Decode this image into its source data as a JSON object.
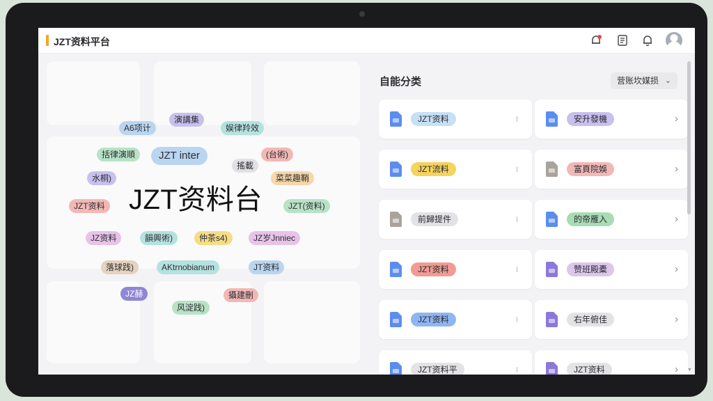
{
  "app": {
    "title": "JZT资料平台",
    "accent": "#f5a623"
  },
  "header": {
    "icons": [
      "notification-badge-icon",
      "document-list-icon",
      "bell-icon",
      "user-avatar-icon"
    ]
  },
  "cloud": {
    "headline": "JZT资料台",
    "tags": [
      {
        "text": "A6项计",
        "color": "c-blue"
      },
      {
        "text": "演講集",
        "color": "c-purple"
      },
      {
        "text": "娱律羚效",
        "color": "c-teal"
      },
      {
        "text": "括律演順",
        "color": "c-green"
      },
      {
        "text": "JZT inter",
        "color": "c-blue"
      },
      {
        "text": "搖載",
        "color": "c-gray"
      },
      {
        "text": "(台術)",
        "color": "c-red"
      },
      {
        "text": "水桐)",
        "color": "c-purple"
      },
      {
        "text": "菜菜趣鞘",
        "color": "c-orange"
      },
      {
        "text": "JZT资料",
        "color": "c-red"
      },
      {
        "text": "JZT(资料)",
        "color": "c-green"
      },
      {
        "text": "JZ资料",
        "color": "c-pink"
      },
      {
        "text": "韻興術)",
        "color": "c-teal"
      },
      {
        "text": "仲茶s4)",
        "color": "c-yellow"
      },
      {
        "text": "JZ岁Jnniec",
        "color": "c-pink"
      },
      {
        "text": "落球践)",
        "color": "c-tan"
      },
      {
        "text": "AKtrnobianum",
        "color": "c-teal"
      },
      {
        "text": "JT资料",
        "color": "c-blue"
      },
      {
        "text": "JZ赫",
        "color": "c-violet"
      },
      {
        "text": "攝建刪",
        "color": "c-red"
      },
      {
        "text": "风淀践)",
        "color": "c-green"
      }
    ]
  },
  "panel": {
    "title": "自能分类",
    "sort_label": "营账坎媒损",
    "cards": [
      {
        "label": "JZT资料",
        "tag_color": "#c6e0f6",
        "icon": "doc-blue"
      },
      {
        "label": "安升發機",
        "tag_color": "#c9c0ee",
        "icon": "doc-blue"
      },
      {
        "label": "JZT流料",
        "tag_color": "#f5d35c",
        "icon": "doc-blue"
      },
      {
        "label": "富頁院娛",
        "tag_color": "#f2b8b5",
        "icon": "doc-gray"
      },
      {
        "label": "前歸提件",
        "tag_color": "#e3e3e6",
        "icon": "doc-gray"
      },
      {
        "label": "的帝雁入",
        "tag_color": "#a8dcb5",
        "icon": "doc-blue"
      },
      {
        "label": "JZT资料",
        "tag_color": "#f09b93",
        "icon": "doc-blue"
      },
      {
        "label": "赞班殿橐",
        "tag_color": "#dcc6ec",
        "icon": "doc-purple"
      },
      {
        "label": "JZT资料",
        "tag_color": "#8fb6f3",
        "icon": "doc-blue"
      },
      {
        "label": "右年俯佳",
        "tag_color": "#e3e3e6",
        "icon": "doc-purple"
      },
      {
        "label": "JZT资料平",
        "tag_color": "#e3e3e6",
        "icon": "doc-blue"
      },
      {
        "label": "JZT资料",
        "tag_color": "#e3e3e6",
        "icon": "doc-purple"
      }
    ]
  }
}
